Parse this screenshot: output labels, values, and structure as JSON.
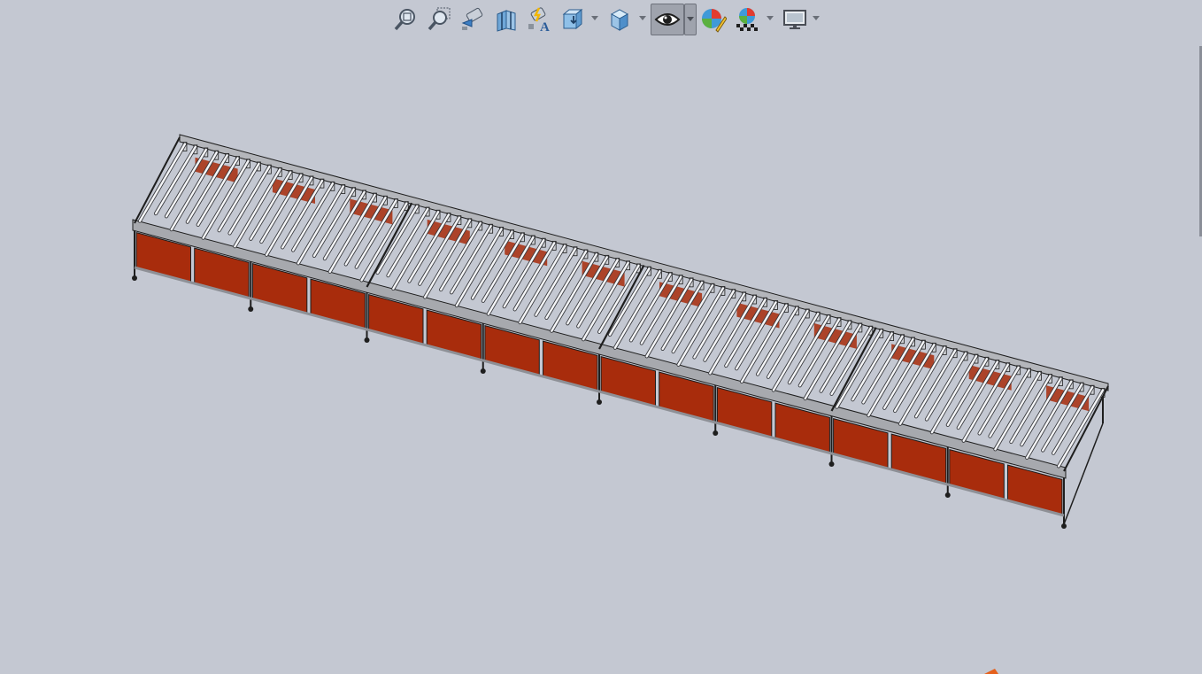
{
  "window": {
    "title": ""
  },
  "heads_up_toolbar": {
    "buttons": [
      {
        "id": "zoom-to-fit",
        "icon": "zoom-to-fit-icon",
        "active": false,
        "has_dropdown": false
      },
      {
        "id": "zoom-to-area",
        "icon": "zoom-to-area-icon",
        "active": false,
        "has_dropdown": false
      },
      {
        "id": "previous-view",
        "icon": "previous-view-icon",
        "active": false,
        "has_dropdown": false
      },
      {
        "id": "section-view",
        "icon": "section-view-icon",
        "active": false,
        "has_dropdown": false
      },
      {
        "id": "dynamic-annotation-views",
        "icon": "dynamic-annotation-icon",
        "active": false,
        "has_dropdown": false
      },
      {
        "id": "view-orientation",
        "icon": "view-orientation-icon",
        "active": false,
        "has_dropdown": true
      },
      {
        "id": "display-style",
        "icon": "display-style-cube-icon",
        "active": false,
        "has_dropdown": true
      },
      {
        "id": "hide-show-items",
        "icon": "eye-icon",
        "active": true,
        "has_dropdown": true
      },
      {
        "id": "edit-appearance",
        "icon": "edit-appearance-icon",
        "active": false,
        "has_dropdown": false
      },
      {
        "id": "apply-scene",
        "icon": "apply-scene-icon",
        "active": false,
        "has_dropdown": true
      },
      {
        "id": "view-settings",
        "icon": "monitor-icon",
        "active": false,
        "has_dropdown": true
      }
    ]
  },
  "colors": {
    "viewport_background": "#c4c8d2",
    "panel_red": "#a82c0c",
    "roller_white": "#f4f5f7",
    "frame_grey": "#8e9096",
    "edge_dark": "#1e1e1e",
    "active_button": "#9fa3ad"
  },
  "model": {
    "description_visible": false,
    "module_count": 4,
    "rollers_per_module": 22,
    "panels_per_module": 4
  }
}
